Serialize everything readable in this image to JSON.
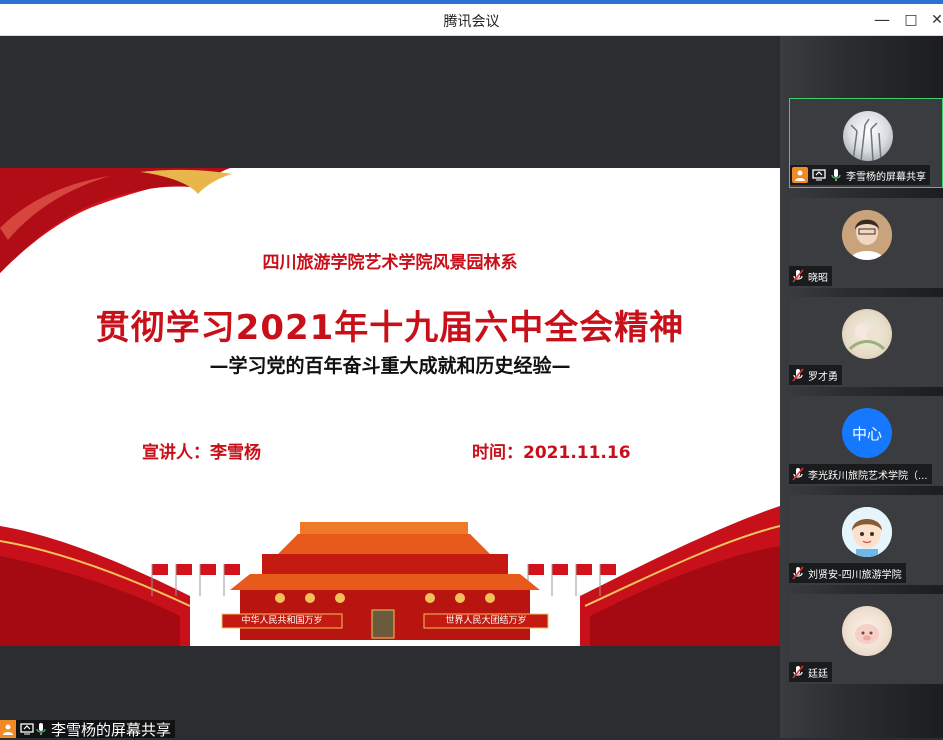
{
  "window": {
    "title": "腾讯会议",
    "minimize": "—",
    "maximize": "□",
    "close": "✕"
  },
  "slide": {
    "org": "四川旅游学院艺术学院风景园林系",
    "title": "贯彻学习2021年十九届六中全会精神",
    "subtitle": "—学习党的百年奋斗重大成就和历史经验—",
    "speaker": "宣讲人：李雪杨",
    "time": "时间：2021.11.16",
    "banner_left": "中华人民共和国万岁",
    "banner_right": "世界人民大团结万岁"
  },
  "participants": [
    {
      "name": "李雪杨的屏幕共享",
      "avatar": "snow-photo"
    },
    {
      "name": "晓昭",
      "avatar": "person-photo"
    },
    {
      "name": "罗才勇",
      "avatar": "flower-photo"
    },
    {
      "name": "李光跃川旅院艺术学院（...",
      "avatar": "text",
      "avatar_text": "中心",
      "avatar_color": "#1677ff"
    },
    {
      "name": "刘贤安-四川旅游学院",
      "avatar": "cartoon-boy"
    },
    {
      "name": "廷廷",
      "avatar": "pig-photo"
    }
  ],
  "bottom_share": {
    "name": "李雪杨的屏幕共享"
  },
  "colors": {
    "accent_red": "#c8101a",
    "active_border": "#3fcf6f",
    "share_orange": "#f08a24"
  }
}
